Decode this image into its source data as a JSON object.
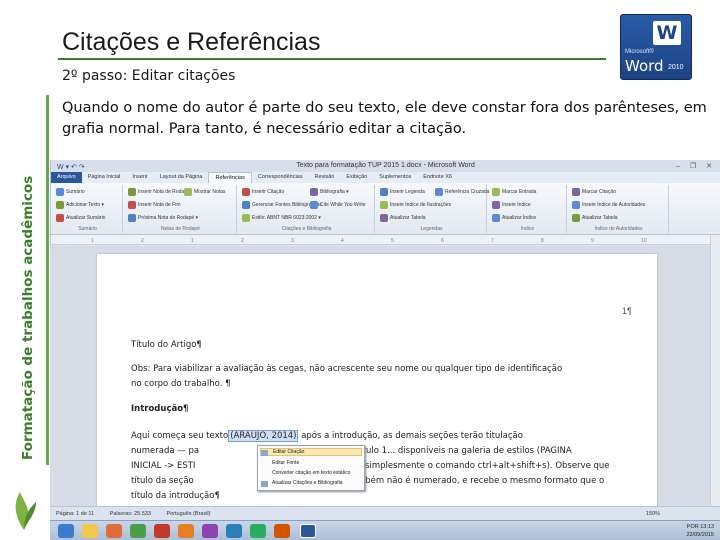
{
  "side_label": "Formatação de trabalhos acadêmicos",
  "title": "Citações e Referências",
  "subtitle": "2º passo: Editar citações",
  "body_text": "Quando o nome do autor é parte do seu texto, ele deve constar fora dos parênteses, em grafia normal. Para tanto, é necessário editar a citação.",
  "logo": {
    "microsoft": "Microsoft®",
    "word": "Word",
    "year": "2010"
  },
  "word": {
    "window_title": "Texto para formatação TUP 2015 1.docx - Microsoft Word",
    "tabs": [
      "Arquivo",
      "Página Inicial",
      "Inserir",
      "Layout da Página",
      "Referências",
      "Correspondências",
      "Revisão",
      "Exibição",
      "Suplementos",
      "Endnote X6"
    ],
    "active_tab": "Referências",
    "ribbon_groups": [
      {
        "label": "Sumário",
        "items": [
          "Sumário",
          "Adicionar Texto ▾",
          "Atualizar Sumário"
        ]
      },
      {
        "label": "Notas de Rodapé",
        "items": [
          "Inserir Nota de Rodapé",
          "Inserir Nota de Fim",
          "Próxima Nota de Rodapé ▾",
          "Mostrar Notas"
        ]
      },
      {
        "label": "Citações e Bibliografia",
        "items": [
          "Inserir Citação",
          "Gerenciar Fontes Bibliográficas",
          "Estilo: ABNT NBR 6023:2002 ▾",
          "Bibliografia ▾",
          "Cite While You Write"
        ]
      },
      {
        "label": "Legendas",
        "items": [
          "Inserir Legenda",
          "Inserir Índice de Ilustrações",
          "Atualizar Tabela",
          "Referência Cruzada"
        ]
      },
      {
        "label": "Índice",
        "items": [
          "Marcar Entrada",
          "Inserir Índice",
          "Atualizar Índice"
        ]
      },
      {
        "label": "Índice de Autoridades",
        "items": [
          "Marcar Citação",
          "Inserir Índice de Autoridades",
          "Atualizar Tabela"
        ]
      }
    ],
    "document": {
      "page_number": "1¶",
      "lines": [
        "Título do Artigo¶",
        "Obs: Para viabilizar a avaliação às cegas, não acrescente seu nome ou qualquer tipo de identificação",
        "no corpo do trabalho. ¶",
        "Introdução¶",
        "Aqui começa seu texto",
        "(ARAUJO, 2014)",
        "após a introdução, as demais seções terão titulação",
        "numerada — pa",
        "título 1... disponíveis na galeria de estilos (PAGINA",
        "INICIAL -> ESTI",
        "u simplesmente o comando ctrl+alt+shift+s). Observe que",
        "título da seção",
        "mbém não é numerado, e recebe o mesmo formato que o",
        "título da introdução¶"
      ]
    },
    "context_menu": [
      "Editar Citação",
      "Editar Fonte",
      "Converter citação em texto estático",
      "Atualizar Citações e Bibliografia"
    ],
    "status": {
      "page": "Página: 1 de 11",
      "words": "Palavras: 25.533",
      "language": "Português (Brasil)",
      "zoom": "150%"
    },
    "clock": {
      "time": "13:13",
      "date": "22/09/2015",
      "lang": "POR"
    }
  }
}
